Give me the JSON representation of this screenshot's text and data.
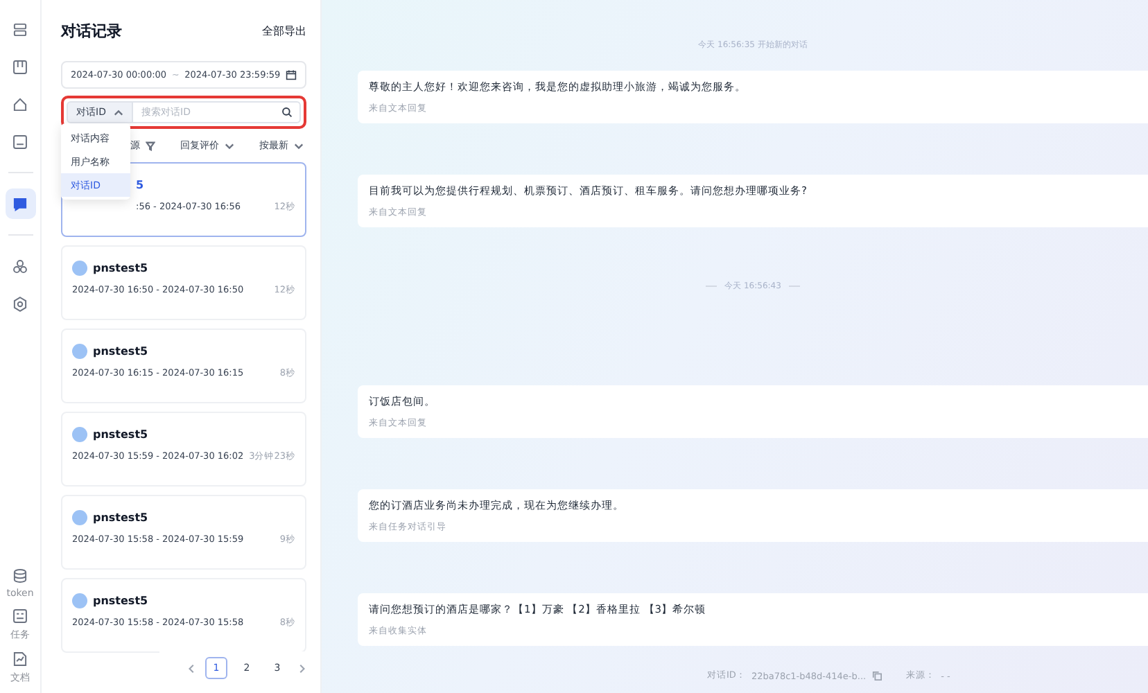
{
  "rail": {
    "top_items": [
      {
        "selected": false
      },
      {
        "selected": false
      },
      {
        "selected": false
      },
      {
        "selected": false
      },
      {
        "selected": true
      },
      {
        "selected": false
      },
      {
        "selected": false
      }
    ],
    "bottom_items": [
      {
        "label": "token"
      },
      {
        "label": "任务"
      },
      {
        "label": "文档"
      }
    ]
  },
  "list": {
    "title": "对话记录",
    "export": "全部导出",
    "date_range": {
      "start": "2024-07-30 00:00:00",
      "separator": "~",
      "end": "2024-07-30 23:59:59"
    },
    "search": {
      "type_selector": "对话ID",
      "placeholder": "搜索对话ID",
      "expanded": true,
      "options": [
        {
          "label": "对话内容",
          "selected": false
        },
        {
          "label": "用户名称",
          "selected": false
        },
        {
          "label": "对话ID",
          "selected": true
        }
      ]
    },
    "filters": [
      {
        "label": "源",
        "kind": "filter"
      },
      {
        "label": "回复评价",
        "kind": "caret"
      },
      {
        "label": "按最新",
        "kind": "caret"
      }
    ],
    "conversations": [
      {
        "name": "5",
        "time": ":56 - 2024-07-30 16:56",
        "duration": "12秒",
        "selected": true
      },
      {
        "name": "pnstest5",
        "time": "2024-07-30 16:50 - 2024-07-30 16:50",
        "duration": "12秒",
        "selected": false
      },
      {
        "name": "pnstest5",
        "time": "2024-07-30 16:15 - 2024-07-30 16:15",
        "duration": "8秒",
        "selected": false
      },
      {
        "name": "pnstest5",
        "time": "2024-07-30 15:59 - 2024-07-30 16:02",
        "duration": "3分钟23秒",
        "selected": false
      },
      {
        "name": "pnstest5",
        "time": "2024-07-30 15:58 - 2024-07-30 15:59",
        "duration": "9秒",
        "selected": false
      },
      {
        "name": "pnstest5",
        "time": "2024-07-30 15:58 - 2024-07-30 15:58",
        "duration": "8秒",
        "selected": false
      }
    ],
    "pagination": [
      {
        "label": "1",
        "selected": true
      },
      {
        "label": "2",
        "selected": false
      },
      {
        "label": "3",
        "selected": false
      }
    ]
  },
  "chat": {
    "items": [
      {
        "kind": "time",
        "text": "今天 16:56:35 开始新的对话"
      },
      {
        "kind": "message",
        "text": "尊敬的主人您好！欢迎您来咨询，我是您的虚拟助理小旅游，竭诚为您服务。",
        "source": "来自文本回复"
      },
      {
        "kind": "message",
        "text": "目前我可以为您提供行程规划、机票预订、酒店预订、租车服务。请问您想办理哪项业务?",
        "source": "来自文本回复"
      },
      {
        "kind": "time",
        "text": "今天 16:56:43"
      },
      {
        "kind": "message",
        "text": "订饭店包间。",
        "source": "来自文本回复"
      },
      {
        "kind": "message",
        "text": "您的订酒店业务尚未办理完成，现在为您继续办理。",
        "source": "来自任务对话引导"
      },
      {
        "kind": "message",
        "text": "请问您想预订的酒店是哪家？【1】万豪 【2】香格里拉 【3】希尔顿",
        "source": "来自收集实体"
      }
    ],
    "footer": {
      "id_label": "对话ID：",
      "id": "22ba78c1-b48d-414e-b...",
      "source_label": "来源：",
      "source": "- -"
    }
  }
}
